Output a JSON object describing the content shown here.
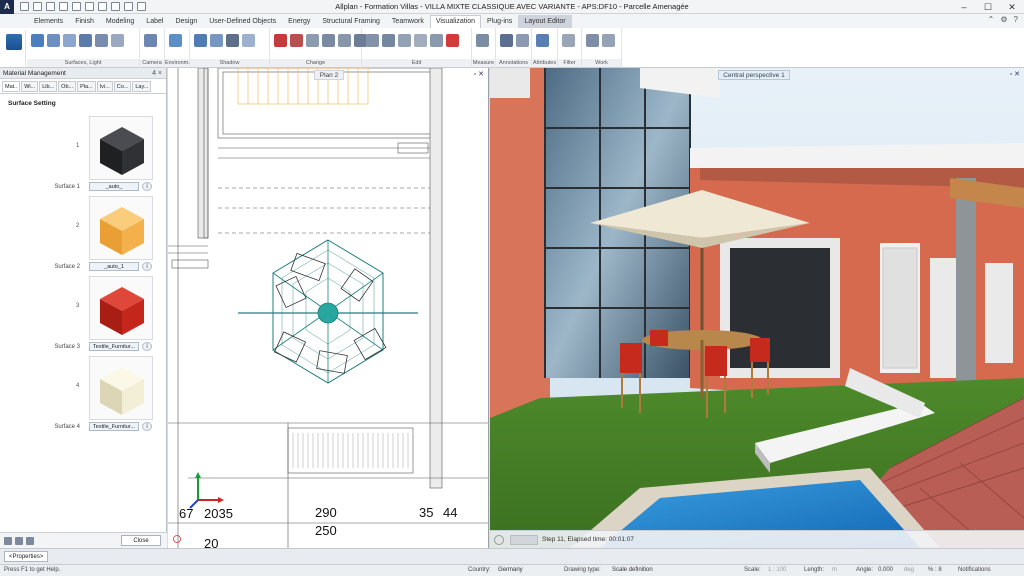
{
  "app": {
    "logo": "A",
    "title": "Allplan - Formation Villas - VILLA MIXTE CLASSIQUE AVEC VARIANTE - APS:DF10 - Parcelle Amenagée"
  },
  "ribbon_tabs": [
    "Elements",
    "Finish",
    "Modeling",
    "Label",
    "Design",
    "User-Defined Objects",
    "Energy",
    "Structural Framing",
    "Teamwork",
    "Visualization",
    "Plug-ins",
    "Layout Editor"
  ],
  "active_tab": "Visualization",
  "ribbon_groups": [
    "Surfaces, Light",
    "Camera",
    "Environm.",
    "Shadow",
    "Change",
    "Edit",
    "Measure",
    "Annotations",
    "Attributes",
    "Filter",
    "Work Environment"
  ],
  "palette": {
    "title": "Material Management",
    "pin": "4 ×",
    "tabs": [
      "Mat..",
      "Wi...",
      "Lib...",
      "Ob...",
      "Pla...",
      "Ivi...",
      "Co...",
      "Lay..."
    ],
    "section": "Surface Setting",
    "surfaces": [
      {
        "num": "1",
        "label": "Surface 1",
        "value": "_auto_",
        "color": "#2a2c2e"
      },
      {
        "num": "2",
        "label": "Surface 2",
        "value": "_auto_1",
        "color": "#f4b04a"
      },
      {
        "num": "3",
        "label": "Surface 3",
        "value": "Textile_Furnitur...",
        "color": "#c5261b"
      },
      {
        "num": "4",
        "label": "Surface 4",
        "value": "Textile_Furnitur...",
        "color": "#f3efd6"
      }
    ],
    "close": "Close",
    "info_glyph": "i"
  },
  "plan": {
    "title": "Plan 2",
    "dims": [
      "67",
      "2035",
      "290",
      "250",
      "35",
      "44",
      "20"
    ]
  },
  "perspective": {
    "title": "Central perspective 1",
    "status": "Step 11, Elapsed time: 00:01:07"
  },
  "viewport_controls": "▫ ✕",
  "properties": "<Properties>",
  "statusbar": {
    "help": "Press F1 to get Help.",
    "country_label": "Country:",
    "country": "Germany",
    "drawing_type_label": "Drawing type:",
    "drawing_type": "Scale definition",
    "scale_label": "Scale:",
    "scale": "1 : 100",
    "length_label": "Length:",
    "length": "m",
    "angle_label": "Angle:",
    "angle": "0.000",
    "angle_unit": "deg",
    "percent": "% : 8",
    "notifications": "Notifications"
  }
}
